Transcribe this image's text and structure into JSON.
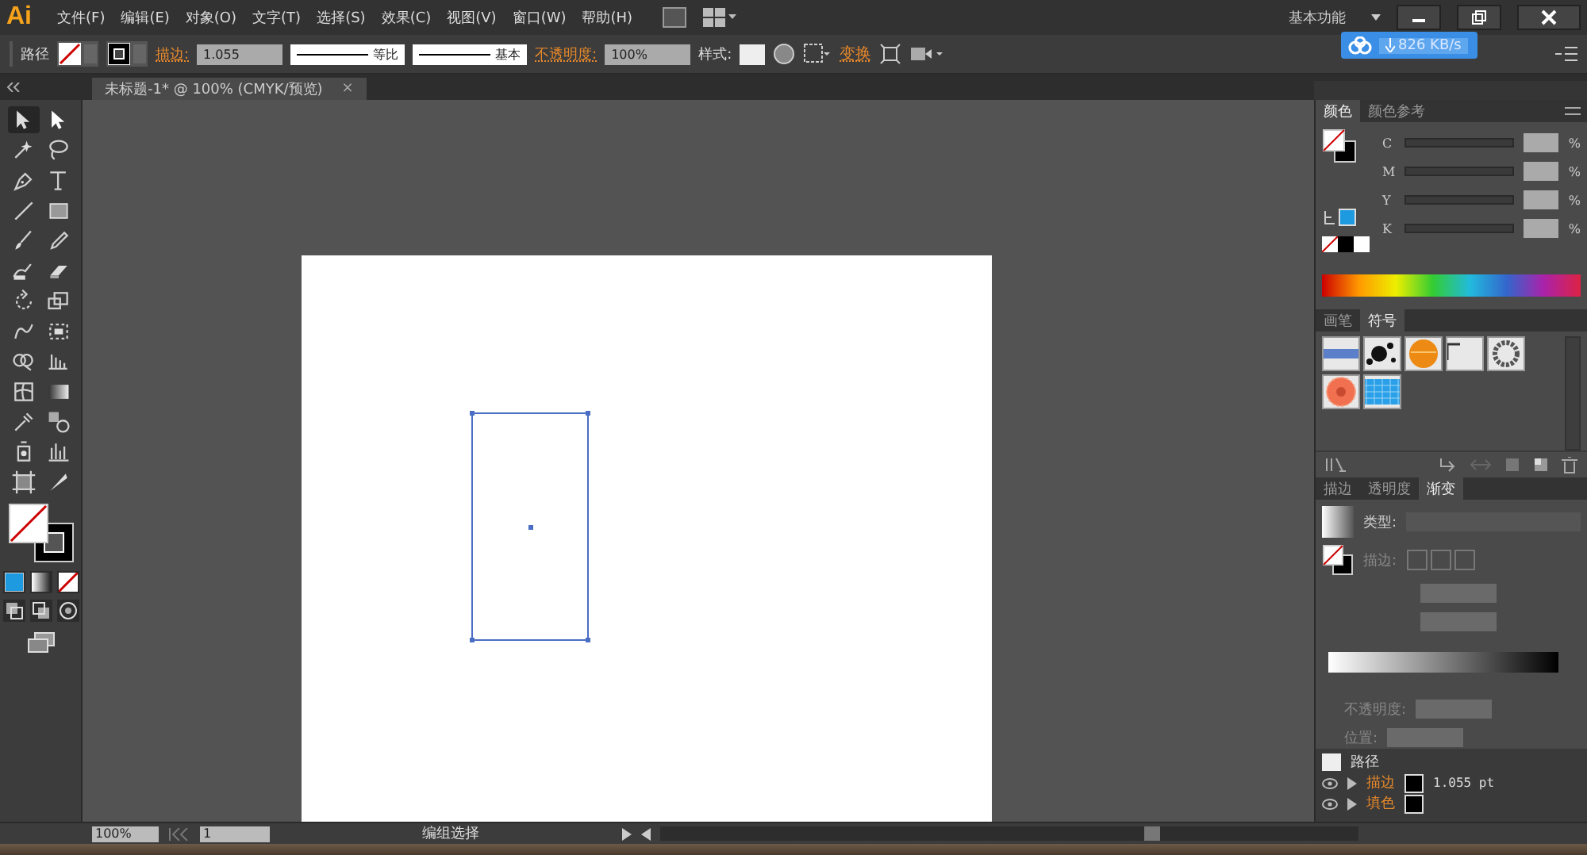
{
  "app": {
    "logo": "Ai"
  },
  "menu": [
    "文件(F)",
    "编辑(E)",
    "对象(O)",
    "文字(T)",
    "选择(S)",
    "效果(C)",
    "视图(V)",
    "窗口(W)",
    "帮助(H)"
  ],
  "workspace": "基本功能",
  "download_badge": "826 KB/s",
  "control_bar": {
    "selection": "路径",
    "stroke_label": "描边:",
    "stroke_weight": "1.055",
    "profile": "等比",
    "brush": "基本",
    "opacity_label": "不透明度:",
    "opacity": "100%",
    "style_label": "样式:",
    "transform": "变换"
  },
  "document_tab": {
    "title": "未标题-1* @ 100% (CMYK/预览)",
    "close": "×"
  },
  "tools": [
    {
      "selected": true
    },
    {
      "selected": false
    },
    {
      "selected": false
    },
    {
      "selected": false
    },
    {
      "selected": false
    },
    {
      "selected": false
    },
    {
      "selected": false
    },
    {
      "selected": false
    },
    {
      "selected": false
    },
    {
      "selected": false
    },
    {
      "selected": false
    },
    {
      "selected": false
    },
    {
      "selected": false
    },
    {
      "selected": false
    },
    {
      "selected": false
    },
    {
      "selected": false
    },
    {
      "selected": false
    },
    {
      "selected": false
    },
    {
      "selected": false
    },
    {
      "selected": false
    },
    {
      "selected": false
    },
    {
      "selected": false
    },
    {
      "selected": false
    },
    {
      "selected": false
    },
    {
      "selected": false
    },
    {
      "selected": false
    }
  ],
  "color_panel": {
    "tabs": [
      {
        "label": "颜色",
        "selected": true
      },
      {
        "label": "颜色参考",
        "selected": false
      }
    ],
    "channels": [
      {
        "name": "C",
        "unit": "%",
        "level": 0
      },
      {
        "name": "M",
        "unit": "%",
        "level": 0
      },
      {
        "name": "Y",
        "unit": "%",
        "level": 0
      },
      {
        "name": "K",
        "unit": "%",
        "level": 0
      }
    ]
  },
  "symbols_panel": {
    "tabs": [
      {
        "label": "画笔",
        "selected": false
      },
      {
        "label": "符号",
        "selected": true
      }
    ],
    "symbols": [
      {
        "kind": "banner"
      },
      {
        "kind": "splat"
      },
      {
        "kind": "orb"
      },
      {
        "kind": "frame"
      },
      {
        "kind": "wreath"
      },
      {
        "kind": "flower"
      },
      {
        "kind": "grid"
      }
    ]
  },
  "gradient_panel": {
    "tabs": [
      {
        "label": "描边",
        "selected": false
      },
      {
        "label": "透明度",
        "selected": false
      },
      {
        "label": "渐变",
        "selected": true
      }
    ],
    "type_label": "类型:",
    "stroke_label": "描边:",
    "opacity_label": "不透明度:",
    "location_label": "位置:"
  },
  "appearance_panel": {
    "title": "路径",
    "rows": [
      {
        "label": "描边",
        "value": "1.055 pt"
      },
      {
        "label": "填色"
      }
    ]
  },
  "status_bar": {
    "zoom": "100%",
    "artboard": "1",
    "tool": "编组选择"
  }
}
